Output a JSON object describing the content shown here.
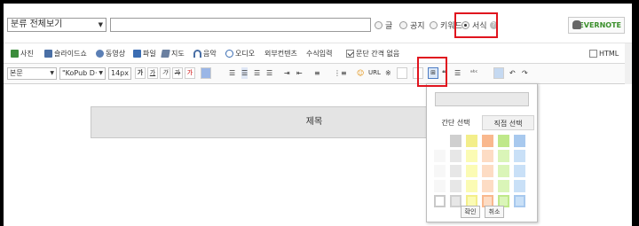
{
  "category": {
    "selected": "분류 전체보기"
  },
  "visibility": [
    {
      "label": "글",
      "checked": false
    },
    {
      "label": "공지",
      "checked": false
    },
    {
      "label": "키워드",
      "checked": false
    },
    {
      "label": "서식",
      "checked": true
    }
  ],
  "evernote_label": "EVERNOTE",
  "insert_bar": [
    {
      "label": "사진",
      "icon": "photo-icon",
      "color": "#3c8c3c"
    },
    {
      "label": "슬라이드쇼",
      "icon": "slideshow-icon",
      "color": "#4a6fa5"
    },
    {
      "label": "동영상",
      "icon": "video-icon",
      "color": "#5b7fb5"
    },
    {
      "label": "파일",
      "icon": "file-icon",
      "color": "#3b6db3"
    },
    {
      "label": "지도",
      "icon": "map-icon",
      "color": "#6a7fa0"
    },
    {
      "label": "음악",
      "icon": "music-icon",
      "color": "#4a6fa5"
    },
    {
      "label": "오디오",
      "icon": "audio-icon",
      "color": "#3b6db3"
    },
    {
      "label": "외부컨텐츠",
      "icon": "",
      "color": ""
    },
    {
      "label": "수식입력",
      "icon": "",
      "color": ""
    }
  ],
  "paragraph_option": {
    "label": "문단 간격 없음",
    "checked": true
  },
  "html_option": {
    "label": "HTML",
    "checked": false
  },
  "format_bar": {
    "block": "본문",
    "font": "\"KoPub D·",
    "size": "14px",
    "buttons": [
      "가",
      "가",
      "가",
      "가",
      "가"
    ],
    "url_label": "URL",
    "extra_label": "ᵃᵇᶜ"
  },
  "editor": {
    "title_placeholder": "제목"
  },
  "table_popup": {
    "tab_simple": "간단 선택",
    "tab_custom": "직접 선택",
    "confirm": "확인",
    "cancel": "취소",
    "columns": [
      "#e7e7e7",
      "#fbfbb4",
      "#fddcc4",
      "#daf5b8",
      "#c9e0f7"
    ],
    "column_dark": [
      "#cfcfcf",
      "#f3ee8a",
      "#f9b88e",
      "#bfe88a",
      "#a8c9ee"
    ]
  }
}
